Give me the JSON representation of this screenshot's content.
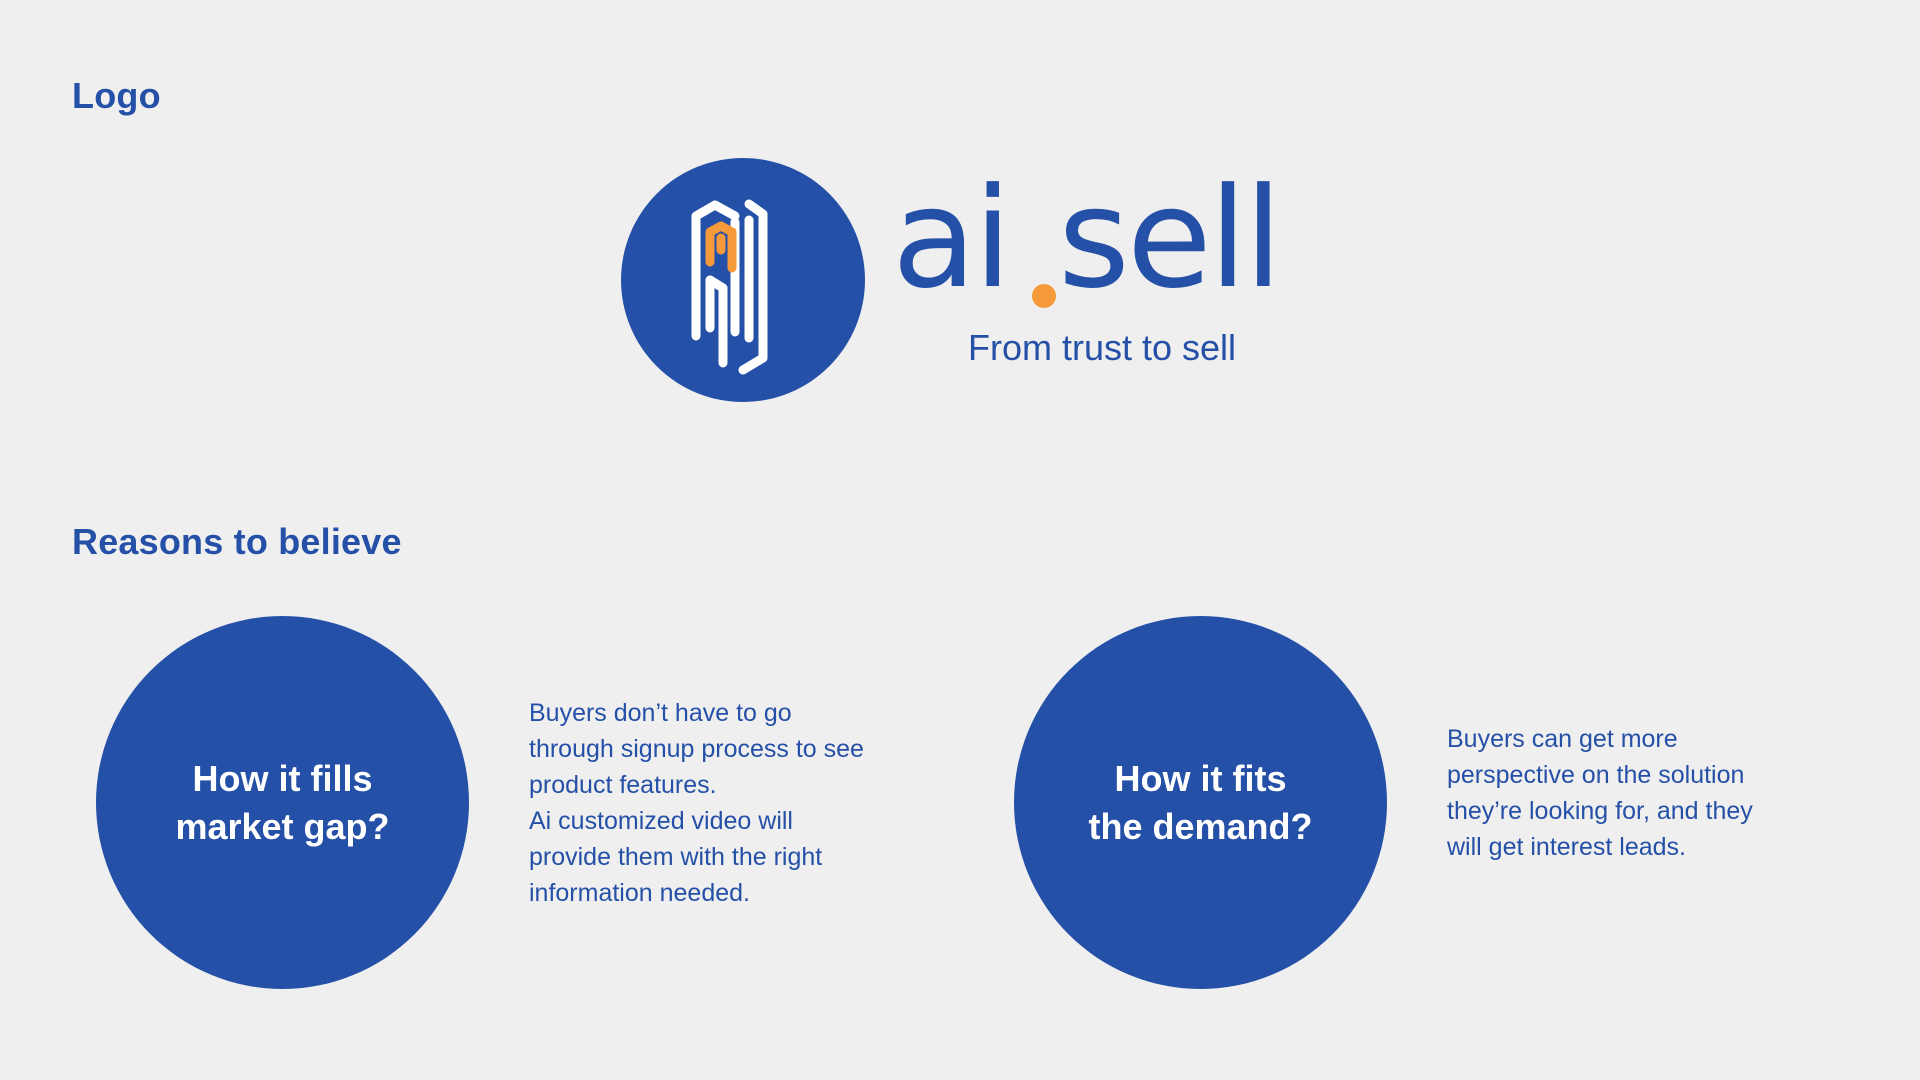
{
  "sections": {
    "logo_heading": "Logo",
    "reasons_heading": "Reasons to believe"
  },
  "logo": {
    "wordmark_ai": "ai",
    "wordmark_sell": "sell",
    "tagline": "From trust to sell",
    "colors": {
      "brand_blue": "#2550a7",
      "accent_orange": "#f6993a",
      "background": "#efefef"
    }
  },
  "reasons": [
    {
      "circle_label": "How it fills\nmarket gap?",
      "lines": [
        "Buyers don’t have to go",
        "through signup process to see",
        "product features.",
        "Ai customized video will",
        "provide them with the right",
        "information needed."
      ]
    },
    {
      "circle_label": "How it fits\nthe demand?",
      "lines": [
        "Buyers can get more",
        "perspective on the solution",
        "they’re looking for, and they",
        "will get interest leads."
      ]
    }
  ]
}
